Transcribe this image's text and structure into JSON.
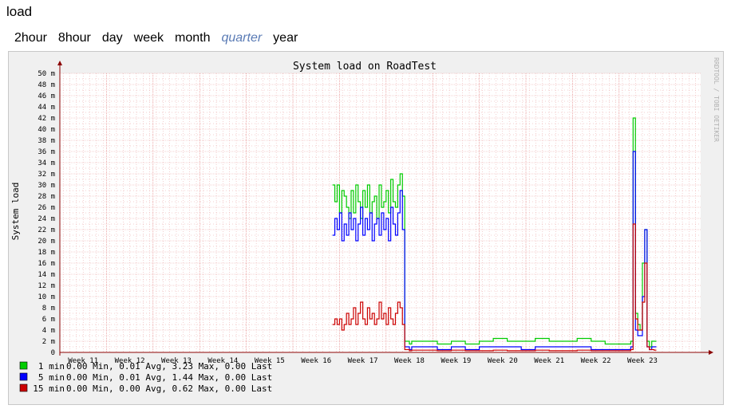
{
  "page": {
    "title": "load"
  },
  "tabs": [
    {
      "label": "2hour",
      "active": false
    },
    {
      "label": "8hour",
      "active": false
    },
    {
      "label": "day",
      "active": false
    },
    {
      "label": "week",
      "active": false
    },
    {
      "label": "month",
      "active": false
    },
    {
      "label": "quarter",
      "active": true
    },
    {
      "label": "year",
      "active": false
    }
  ],
  "colors": {
    "accent": "#5a7bb5",
    "grid": "#e8a0a0",
    "axis": "#8b0000"
  },
  "chart_data": {
    "type": "line",
    "title": "System load on RoadTest",
    "ylabel": "System load",
    "xlabel": "",
    "watermark": "RRDTOOL / TOBI OETIKER",
    "ylim": [
      0,
      50
    ],
    "y_unit": "m",
    "y_ticks": [
      0,
      2,
      4,
      6,
      8,
      10,
      12,
      14,
      16,
      18,
      20,
      22,
      24,
      26,
      28,
      30,
      32,
      34,
      36,
      38,
      40,
      42,
      44,
      46,
      48,
      50
    ],
    "y_tick_labels": [
      "0",
      "2 m",
      "4 m",
      "6 m",
      "8 m",
      "10 m",
      "12 m",
      "14 m",
      "16 m",
      "18 m",
      "20 m",
      "22 m",
      "24 m",
      "26 m",
      "28 m",
      "30 m",
      "32 m",
      "34 m",
      "36 m",
      "38 m",
      "40 m",
      "42 m",
      "44 m",
      "46 m",
      "48 m",
      "50 m"
    ],
    "x_tick_labels": [
      "Week 11",
      "Week 12",
      "Week 13",
      "Week 14",
      "Week 15",
      "Week 16",
      "Week 17",
      "Week 18",
      "Week 19",
      "Week 20",
      "Week 21",
      "Week 22",
      "Week 23"
    ],
    "xlim": [
      10.5,
      24.25
    ],
    "series": [
      {
        "name": "1 min",
        "color": "#00cc00",
        "x": [
          16.35,
          16.4,
          16.45,
          16.5,
          16.55,
          16.6,
          16.65,
          16.7,
          16.75,
          16.8,
          16.85,
          16.9,
          16.95,
          17.0,
          17.05,
          17.1,
          17.15,
          17.2,
          17.25,
          17.3,
          17.35,
          17.4,
          17.45,
          17.5,
          17.55,
          17.6,
          17.65,
          17.7,
          17.75,
          17.8,
          17.85,
          17.9,
          17.95,
          18.0,
          18.05,
          18.3,
          18.6,
          18.9,
          19.2,
          19.5,
          19.8,
          20.1,
          20.4,
          20.7,
          21.0,
          21.3,
          21.6,
          21.9,
          22.2,
          22.5,
          22.7,
          22.75,
          22.8,
          22.85,
          22.9,
          22.95,
          23.0,
          23.05,
          23.1,
          23.15,
          23.2,
          23.25,
          23.3
        ],
        "values": [
          30,
          27,
          30,
          25,
          29,
          28,
          26,
          24,
          29,
          25,
          30,
          27,
          24,
          29,
          26,
          30,
          25,
          27,
          28,
          24,
          30,
          26,
          27,
          29,
          25,
          31,
          27,
          26,
          30,
          32,
          28,
          2,
          2,
          1.5,
          2,
          2,
          1.5,
          2,
          1.5,
          2,
          2.5,
          2,
          2,
          2.5,
          2,
          2,
          2.5,
          2,
          1.5,
          1.5,
          1.5,
          2,
          42,
          7,
          5,
          4,
          16,
          22,
          2,
          1,
          2,
          2,
          2
        ]
      },
      {
        "name": "5 min",
        "color": "#0000ff",
        "x": [
          16.35,
          16.4,
          16.45,
          16.5,
          16.55,
          16.6,
          16.65,
          16.7,
          16.75,
          16.8,
          16.85,
          16.9,
          16.95,
          17.0,
          17.05,
          17.1,
          17.15,
          17.2,
          17.25,
          17.3,
          17.35,
          17.4,
          17.45,
          17.5,
          17.55,
          17.6,
          17.65,
          17.7,
          17.75,
          17.8,
          17.85,
          17.9,
          17.95,
          18.0,
          18.05,
          18.3,
          18.6,
          18.9,
          19.2,
          19.5,
          19.8,
          20.1,
          20.4,
          20.7,
          21.0,
          21.3,
          21.6,
          21.9,
          22.2,
          22.5,
          22.7,
          22.75,
          22.8,
          22.85,
          22.9,
          22.95,
          23.0,
          23.05,
          23.1,
          23.15,
          23.2,
          23.25,
          23.3
        ],
        "values": [
          21,
          24,
          22,
          25,
          20,
          23,
          21,
          25,
          22,
          24,
          20,
          23,
          26,
          21,
          24,
          22,
          25,
          20,
          23,
          24,
          21,
          25,
          22,
          24,
          20,
          26,
          23,
          21,
          25,
          29,
          22,
          1,
          1,
          0.5,
          1,
          1,
          0.5,
          1,
          0.5,
          1,
          1,
          1,
          0.5,
          1,
          1,
          1,
          1,
          0.5,
          0.5,
          0.5,
          0.5,
          1,
          36,
          4,
          3,
          3,
          10,
          22,
          1,
          0.5,
          1,
          1,
          1
        ]
      },
      {
        "name": "15 min",
        "color": "#cc0000",
        "x": [
          16.35,
          16.4,
          16.45,
          16.5,
          16.55,
          16.6,
          16.65,
          16.7,
          16.75,
          16.8,
          16.85,
          16.9,
          16.95,
          17.0,
          17.05,
          17.1,
          17.15,
          17.2,
          17.25,
          17.3,
          17.35,
          17.4,
          17.45,
          17.5,
          17.55,
          17.6,
          17.65,
          17.7,
          17.75,
          17.8,
          17.85,
          17.9,
          17.95,
          18.0,
          18.05,
          18.3,
          18.6,
          18.9,
          19.2,
          19.5,
          19.8,
          20.1,
          20.4,
          20.7,
          21.0,
          21.3,
          21.6,
          21.9,
          22.2,
          22.5,
          22.7,
          22.75,
          22.8,
          22.85,
          22.9,
          22.95,
          23.0,
          23.05,
          23.1,
          23.15,
          23.2,
          23.25,
          23.3
        ],
        "values": [
          5,
          6,
          5,
          6,
          4,
          5,
          7,
          5,
          6,
          8,
          5,
          7,
          9,
          6,
          5,
          8,
          6,
          7,
          5,
          6,
          9,
          6,
          7,
          5,
          8,
          6,
          5,
          7,
          9,
          8,
          5,
          0.5,
          0.5,
          0.3,
          0.4,
          0.4,
          0.3,
          0.4,
          0.3,
          0.3,
          0.4,
          0.3,
          0.3,
          0.4,
          0.3,
          0.3,
          0.4,
          0.3,
          0.3,
          0.3,
          0.3,
          0.5,
          23,
          6,
          4,
          4,
          9,
          16,
          1,
          0.5,
          0.5,
          0.4,
          0.4
        ]
      }
    ],
    "legend": [
      {
        "name": "1 min",
        "color": "#00cc00",
        "text": "  0.00 Min,   0.01 Avg,   3.23 Max,   0.00 Last"
      },
      {
        "name": "5 min",
        "color": "#0000ff",
        "text": "  0.00 Min,   0.01 Avg,   1.44 Max,   0.00 Last"
      },
      {
        "name": "15 min",
        "color": "#cc0000",
        "text": "  0.00 Min,   0.00 Avg,   0.62 Max,   0.00 Last"
      }
    ],
    "grid": true,
    "legend_position": "bottom-left"
  }
}
